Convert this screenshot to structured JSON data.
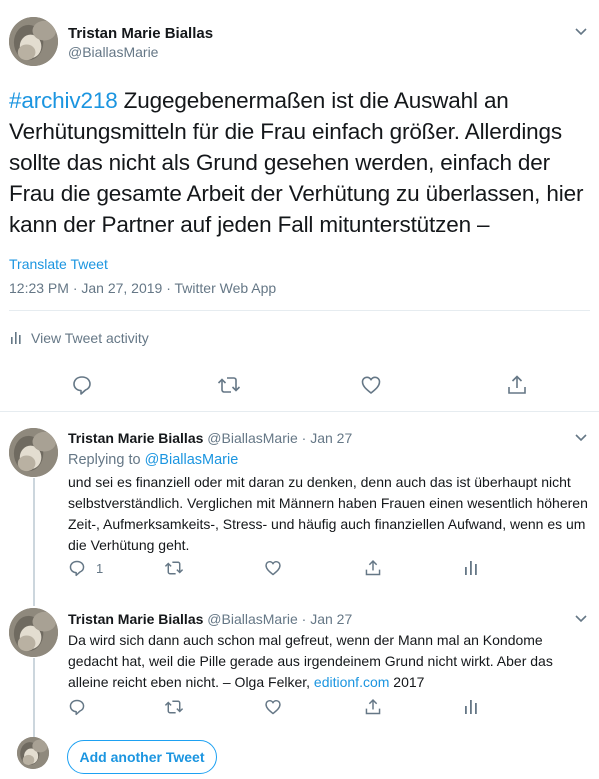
{
  "colors": {
    "link": "#1b95e0",
    "muted": "#657786",
    "text": "#14171a",
    "border": "#e6ecf0",
    "thread_line": "#ccd6dd"
  },
  "main_tweet": {
    "author_name": "Tristan Marie Biallas",
    "handle": "@BiallasMarie",
    "hashtag": "#archiv218",
    "text": " Zugegebenermaßen ist die Auswahl an Verhütungsmitteln für die Frau einfach größer. Allerdings sollte das nicht als Grund gesehen werden, einfach der Frau die gesamte Arbeit der Verhütung zu überlassen, hier kann der Partner auf jeden Fall mitunterstützen –",
    "translate_label": "Translate Tweet",
    "meta": "12:23 PM · Jan 27, 2019 · Twitter Web App",
    "activity_label": "View Tweet activity",
    "action_icons": [
      "reply-icon",
      "retweet-icon",
      "like-icon",
      "share-icon"
    ]
  },
  "replies": [
    {
      "author_name": "Tristan Marie Biallas",
      "handle_date": " @BiallasMarie · Jan 27",
      "replying_label": "Replying to ",
      "replying_handle": "@BiallasMarie",
      "text": "und sei es finanziell oder mit daran zu denken, denn auch das ist überhaupt nicht selbstverständlich. Verglichen mit Männern haben Frauen einen wesentlich höheren Zeit-, Aufmerksamkeits-, Stress- und häufig auch finanziellen Aufwand, wenn es um die Verhütung geht.",
      "reply_count": "1"
    },
    {
      "author_name": "Tristan Marie Biallas",
      "handle_date": " @BiallasMarie · Jan 27",
      "text": "Da wird sich dann auch schon mal gefreut, wenn der Mann mal an Kondome gedacht hat, weil die Pille gerade aus irgendeinem Grund nicht wirkt. Aber das alleine reicht eben nicht. – Olga Felker, ",
      "link": "editionf.com",
      "text_after": " 2017"
    }
  ],
  "compose": {
    "add_label": "Add another Tweet"
  }
}
